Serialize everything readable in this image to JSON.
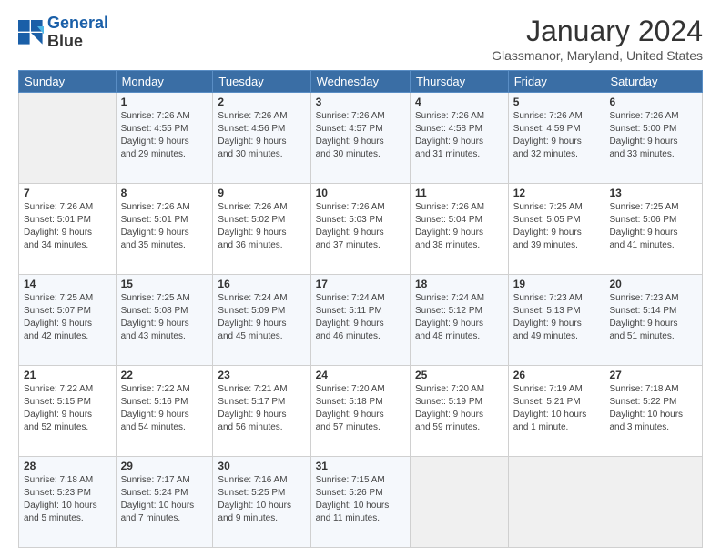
{
  "header": {
    "logo_line1": "General",
    "logo_line2": "Blue",
    "main_title": "January 2024",
    "subtitle": "Glassmanor, Maryland, United States"
  },
  "weekdays": [
    "Sunday",
    "Monday",
    "Tuesday",
    "Wednesday",
    "Thursday",
    "Friday",
    "Saturday"
  ],
  "weeks": [
    [
      {
        "day": "",
        "info": ""
      },
      {
        "day": "1",
        "info": "Sunrise: 7:26 AM\nSunset: 4:55 PM\nDaylight: 9 hours\nand 29 minutes."
      },
      {
        "day": "2",
        "info": "Sunrise: 7:26 AM\nSunset: 4:56 PM\nDaylight: 9 hours\nand 30 minutes."
      },
      {
        "day": "3",
        "info": "Sunrise: 7:26 AM\nSunset: 4:57 PM\nDaylight: 9 hours\nand 30 minutes."
      },
      {
        "day": "4",
        "info": "Sunrise: 7:26 AM\nSunset: 4:58 PM\nDaylight: 9 hours\nand 31 minutes."
      },
      {
        "day": "5",
        "info": "Sunrise: 7:26 AM\nSunset: 4:59 PM\nDaylight: 9 hours\nand 32 minutes."
      },
      {
        "day": "6",
        "info": "Sunrise: 7:26 AM\nSunset: 5:00 PM\nDaylight: 9 hours\nand 33 minutes."
      }
    ],
    [
      {
        "day": "7",
        "info": "Sunrise: 7:26 AM\nSunset: 5:01 PM\nDaylight: 9 hours\nand 34 minutes."
      },
      {
        "day": "8",
        "info": "Sunrise: 7:26 AM\nSunset: 5:01 PM\nDaylight: 9 hours\nand 35 minutes."
      },
      {
        "day": "9",
        "info": "Sunrise: 7:26 AM\nSunset: 5:02 PM\nDaylight: 9 hours\nand 36 minutes."
      },
      {
        "day": "10",
        "info": "Sunrise: 7:26 AM\nSunset: 5:03 PM\nDaylight: 9 hours\nand 37 minutes."
      },
      {
        "day": "11",
        "info": "Sunrise: 7:26 AM\nSunset: 5:04 PM\nDaylight: 9 hours\nand 38 minutes."
      },
      {
        "day": "12",
        "info": "Sunrise: 7:25 AM\nSunset: 5:05 PM\nDaylight: 9 hours\nand 39 minutes."
      },
      {
        "day": "13",
        "info": "Sunrise: 7:25 AM\nSunset: 5:06 PM\nDaylight: 9 hours\nand 41 minutes."
      }
    ],
    [
      {
        "day": "14",
        "info": "Sunrise: 7:25 AM\nSunset: 5:07 PM\nDaylight: 9 hours\nand 42 minutes."
      },
      {
        "day": "15",
        "info": "Sunrise: 7:25 AM\nSunset: 5:08 PM\nDaylight: 9 hours\nand 43 minutes."
      },
      {
        "day": "16",
        "info": "Sunrise: 7:24 AM\nSunset: 5:09 PM\nDaylight: 9 hours\nand 45 minutes."
      },
      {
        "day": "17",
        "info": "Sunrise: 7:24 AM\nSunset: 5:11 PM\nDaylight: 9 hours\nand 46 minutes."
      },
      {
        "day": "18",
        "info": "Sunrise: 7:24 AM\nSunset: 5:12 PM\nDaylight: 9 hours\nand 48 minutes."
      },
      {
        "day": "19",
        "info": "Sunrise: 7:23 AM\nSunset: 5:13 PM\nDaylight: 9 hours\nand 49 minutes."
      },
      {
        "day": "20",
        "info": "Sunrise: 7:23 AM\nSunset: 5:14 PM\nDaylight: 9 hours\nand 51 minutes."
      }
    ],
    [
      {
        "day": "21",
        "info": "Sunrise: 7:22 AM\nSunset: 5:15 PM\nDaylight: 9 hours\nand 52 minutes."
      },
      {
        "day": "22",
        "info": "Sunrise: 7:22 AM\nSunset: 5:16 PM\nDaylight: 9 hours\nand 54 minutes."
      },
      {
        "day": "23",
        "info": "Sunrise: 7:21 AM\nSunset: 5:17 PM\nDaylight: 9 hours\nand 56 minutes."
      },
      {
        "day": "24",
        "info": "Sunrise: 7:20 AM\nSunset: 5:18 PM\nDaylight: 9 hours\nand 57 minutes."
      },
      {
        "day": "25",
        "info": "Sunrise: 7:20 AM\nSunset: 5:19 PM\nDaylight: 9 hours\nand 59 minutes."
      },
      {
        "day": "26",
        "info": "Sunrise: 7:19 AM\nSunset: 5:21 PM\nDaylight: 10 hours\nand 1 minute."
      },
      {
        "day": "27",
        "info": "Sunrise: 7:18 AM\nSunset: 5:22 PM\nDaylight: 10 hours\nand 3 minutes."
      }
    ],
    [
      {
        "day": "28",
        "info": "Sunrise: 7:18 AM\nSunset: 5:23 PM\nDaylight: 10 hours\nand 5 minutes."
      },
      {
        "day": "29",
        "info": "Sunrise: 7:17 AM\nSunset: 5:24 PM\nDaylight: 10 hours\nand 7 minutes."
      },
      {
        "day": "30",
        "info": "Sunrise: 7:16 AM\nSunset: 5:25 PM\nDaylight: 10 hours\nand 9 minutes."
      },
      {
        "day": "31",
        "info": "Sunrise: 7:15 AM\nSunset: 5:26 PM\nDaylight: 10 hours\nand 11 minutes."
      },
      {
        "day": "",
        "info": ""
      },
      {
        "day": "",
        "info": ""
      },
      {
        "day": "",
        "info": ""
      }
    ]
  ]
}
